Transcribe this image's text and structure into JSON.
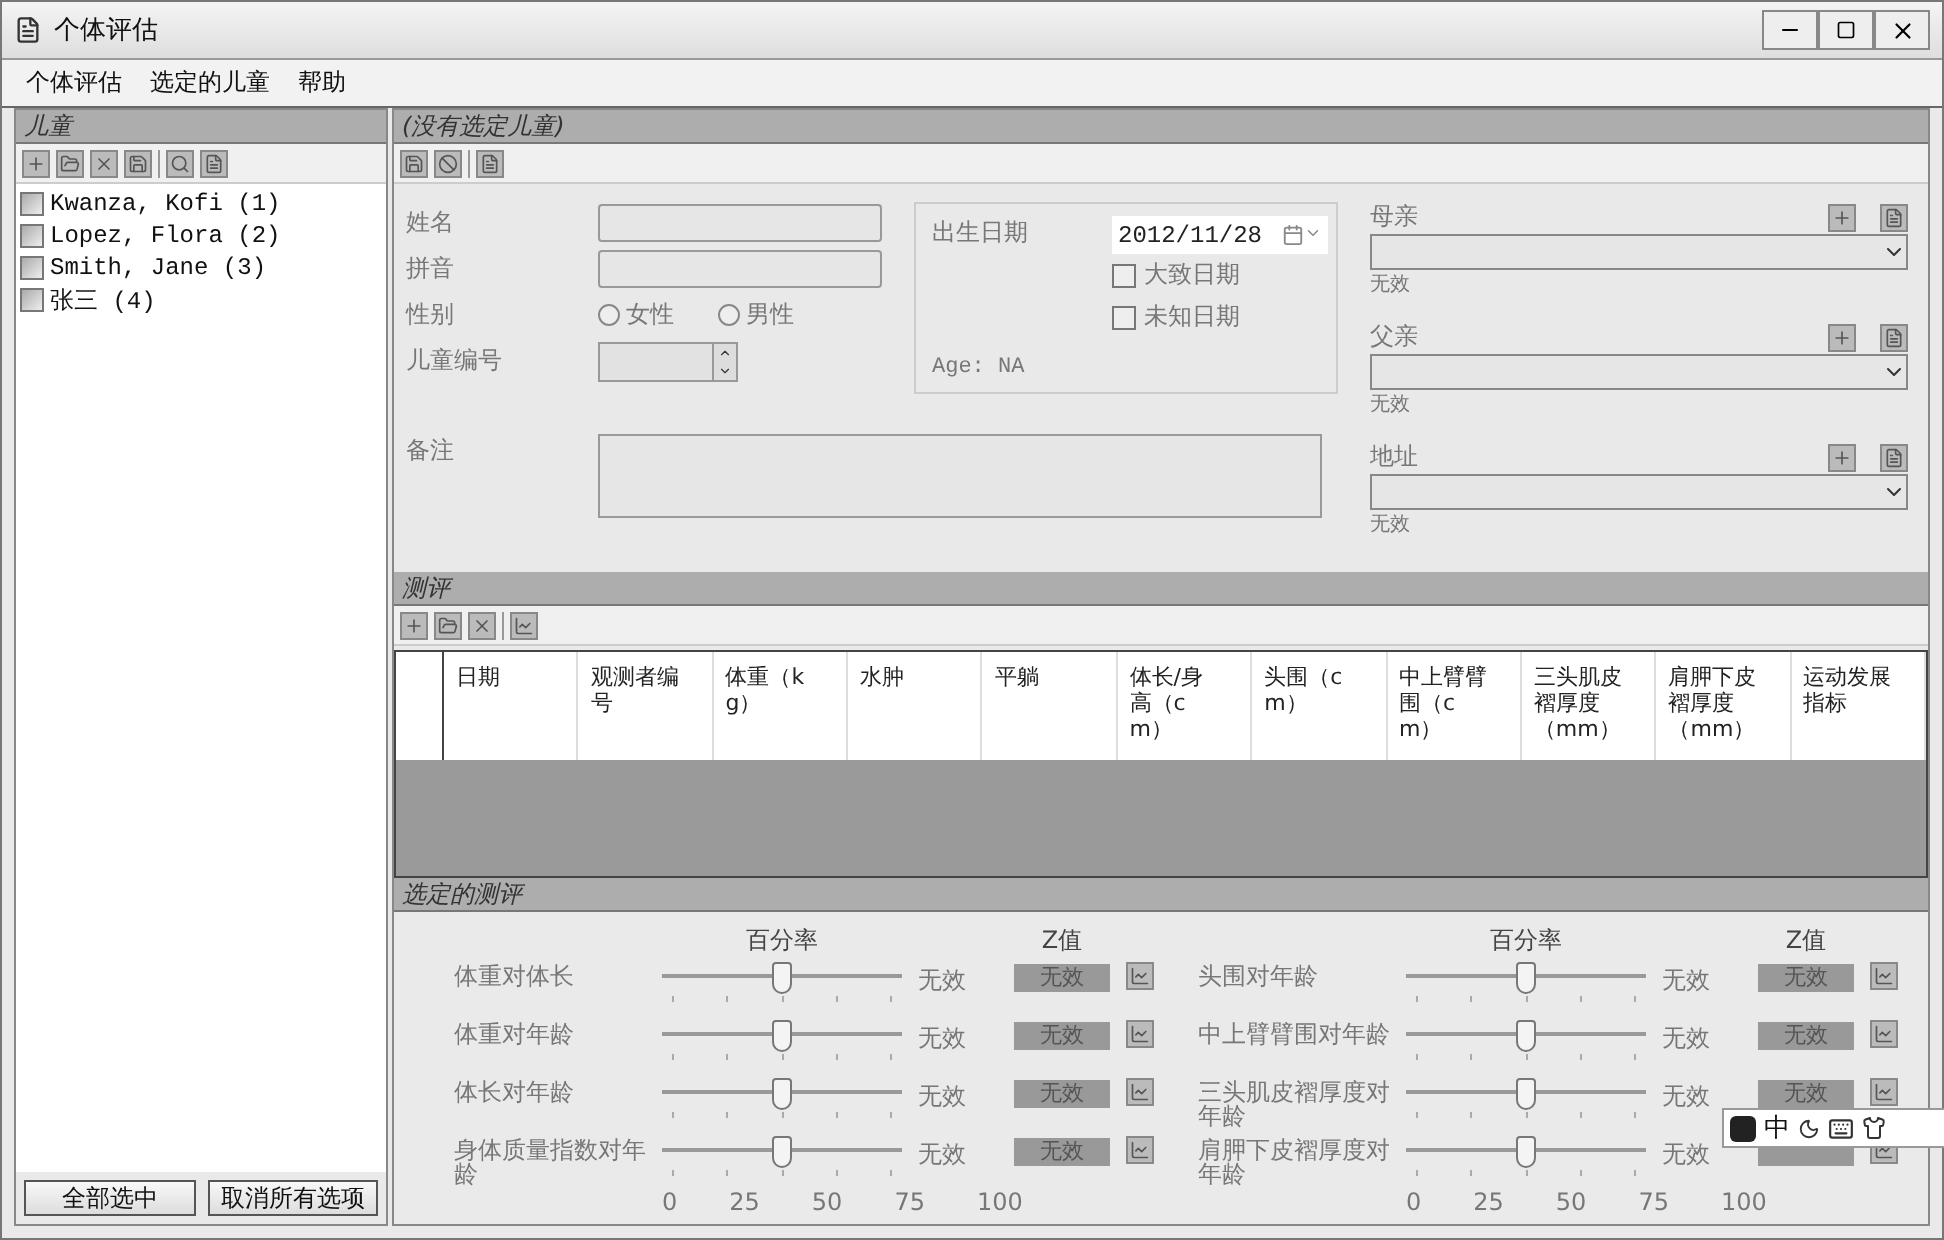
{
  "window": {
    "title": "个体评估"
  },
  "menu": [
    "个体评估",
    "选定的儿童",
    "帮助"
  ],
  "children_panel": {
    "title": "儿童",
    "items": [
      {
        "label": "Kwanza, Kofi (1)",
        "checked": false
      },
      {
        "label": "Lopez, Flora (2)",
        "checked": false
      },
      {
        "label": "Smith, Jane (3)",
        "checked": false
      },
      {
        "label": "张三 (4)",
        "checked": false
      }
    ],
    "buttons": [
      "全部选中",
      "取消所有选项"
    ]
  },
  "child_panel": {
    "title": "(没有选定儿童)",
    "name_label": "姓名",
    "pinyin_label": "拼音",
    "gender_label": "性别",
    "gender_options": [
      {
        "label": "女性",
        "selected": false
      },
      {
        "label": "男性",
        "selected": false
      }
    ],
    "id_label": "儿童编号",
    "notes_label": "备注",
    "birth": {
      "label": "出生日期",
      "date": "2012/11/28",
      "options": [
        {
          "label": "大致日期",
          "checked": false
        },
        {
          "label": "未知日期",
          "checked": false
        }
      ],
      "age": "Age: NA"
    },
    "relations": [
      {
        "label": "母亲",
        "status": "无效"
      },
      {
        "label": "父亲",
        "status": "无效"
      },
      {
        "label": "地址",
        "status": "无效"
      }
    ]
  },
  "assessments": {
    "title": "测评",
    "columns": [
      "日期",
      "观测者编号",
      "体重（kg）",
      "水肿",
      "平躺",
      "体长/身高（cm）",
      "头围（cm）",
      "中上臂臂围（cm）",
      "三头肌皮褶厚度（mm）",
      "肩胛下皮褶厚度（mm）",
      "运动发展指标"
    ]
  },
  "selected_assessment": {
    "title": "选定的测评",
    "groups": [
      {
        "percentile_heading": "百分率",
        "z_heading": "Z值",
        "scale": [
          "0",
          "25",
          "50",
          "75",
          "100"
        ],
        "rows": [
          {
            "label": "体重对体长",
            "level": 0.5,
            "reading": "无效",
            "z_value": "无效"
          },
          {
            "label": "体重对年龄",
            "level": 0.5,
            "reading": "无效",
            "z_value": "无效"
          },
          {
            "label": "体长对年龄",
            "level": 0.5,
            "reading": "无效",
            "z_value": "无效"
          },
          {
            "label": "身体质量指数对年龄",
            "level": 0.5,
            "reading": "无效",
            "z_value": "无效"
          }
        ]
      },
      {
        "percentile_heading": "百分率",
        "z_heading": "Z值",
        "scale": [
          "0",
          "25",
          "50",
          "75",
          "100"
        ],
        "rows": [
          {
            "label": "头围对年龄",
            "level": 0.5,
            "reading": "无效",
            "z_value": "无效"
          },
          {
            "label": "中上臂臂围对年龄",
            "level": 0.5,
            "reading": "无效",
            "z_value": "无效"
          },
          {
            "label": "三头肌皮褶厚度对年龄",
            "level": 0.5,
            "reading": "无效",
            "z_value": "无效"
          },
          {
            "label": "肩胛下皮褶厚度对年龄",
            "level": 0.5,
            "reading": "无效"
          }
        ]
      }
    ]
  },
  "ime_bar": {
    "mode": "中"
  }
}
